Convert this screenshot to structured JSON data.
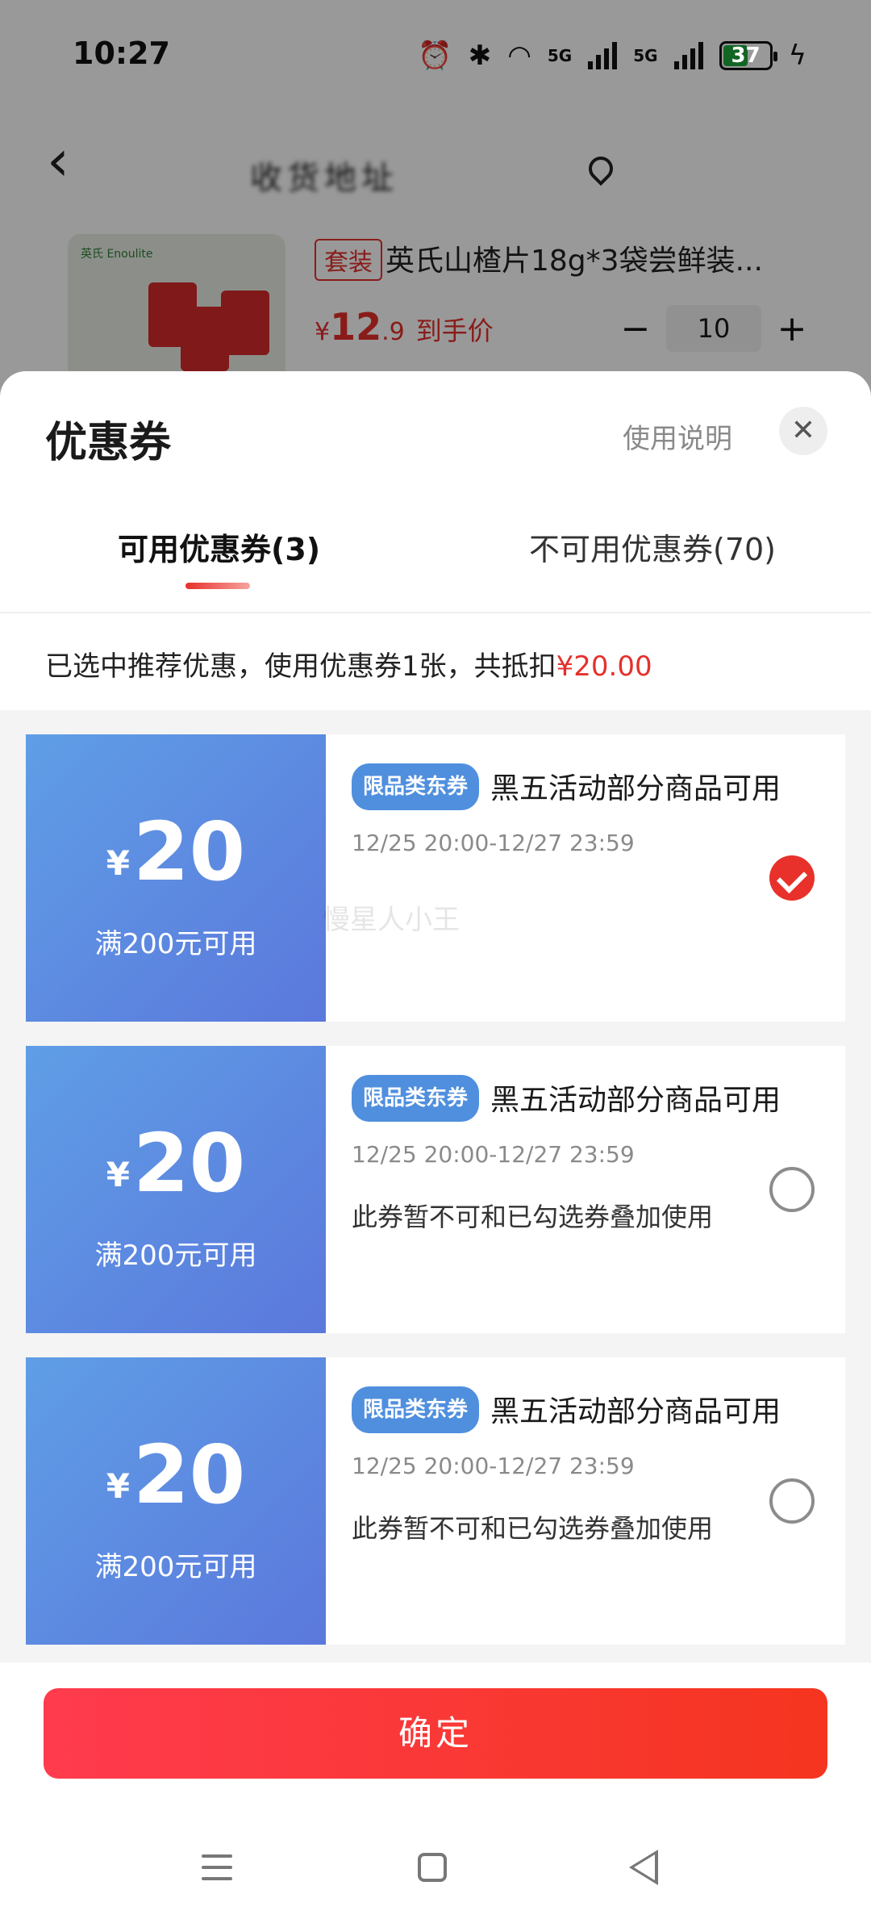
{
  "status_bar": {
    "time": "10:27",
    "net1": "5G",
    "net2": "5G",
    "battery": "37"
  },
  "header": {
    "address": "收货地址"
  },
  "product": {
    "tag": "套装",
    "title": "英氏山楂片18g*3袋尝鲜装...",
    "price_symbol": "¥",
    "price_int": "12",
    "price_dec": ".9",
    "price_label": "到手价",
    "quantity": "10",
    "minus": "−",
    "plus": "+",
    "brand": "英氏 Enoulite"
  },
  "sheet": {
    "title": "优惠券",
    "help": "使用说明",
    "close": "✕",
    "tabs": [
      {
        "label": "可用优惠券(3)"
      },
      {
        "label": "不可用优惠券(70)"
      }
    ],
    "summary_prefix": "已选中推荐优惠，使用优惠券1张，共抵扣",
    "summary_amount": "¥20.00",
    "watermark": "慢星人小王",
    "confirm": "确定"
  },
  "coupons": [
    {
      "currency": "¥",
      "amount": "20",
      "condition": "满200元可用",
      "type": "限品类东券",
      "name": "黑五活动部分商品可用",
      "validity": "12/25 20:00-12/27 23:59",
      "note": "",
      "selected": true
    },
    {
      "currency": "¥",
      "amount": "20",
      "condition": "满200元可用",
      "type": "限品类东券",
      "name": "黑五活动部分商品可用",
      "validity": "12/25 20:00-12/27 23:59",
      "note": "此券暂不可和已勾选券叠加使用",
      "selected": false
    },
    {
      "currency": "¥",
      "amount": "20",
      "condition": "满200元可用",
      "type": "限品类东券",
      "name": "黑五活动部分商品可用",
      "validity": "12/25 20:00-12/27 23:59",
      "note": "此券暂不可和已勾选券叠加使用",
      "selected": false
    }
  ],
  "colors": {
    "accent_red": "#e5302b",
    "coupon_blue": "#5b78dc",
    "tag_blue": "#4f8fde"
  }
}
